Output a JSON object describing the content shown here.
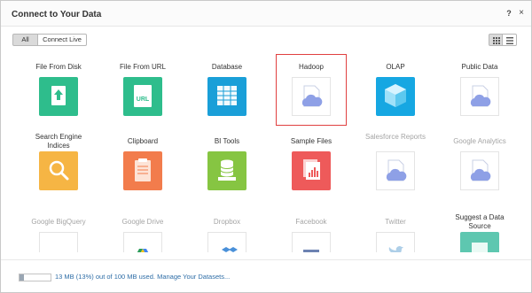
{
  "dialog": {
    "title": "Connect to Your Data",
    "help_label": "?",
    "close_label": "×"
  },
  "filters": {
    "all_label": "All",
    "live_label": "Connect Live",
    "active": "All"
  },
  "view_toggles": [
    "grid-view-icon",
    "list-view-icon"
  ],
  "sources": [
    {
      "label": "File From Disk",
      "icon": "upload-file-icon",
      "color": "#2ebd8c",
      "enabled": true
    },
    {
      "label": "File From URL",
      "icon": "url-file-icon",
      "color": "#2ebd8c",
      "enabled": true
    },
    {
      "label": "Database",
      "icon": "database-icon",
      "color": "#1a9fd8",
      "enabled": true
    },
    {
      "label": "Hadoop",
      "icon": "cloud-doc-icon",
      "color": "#ffffff",
      "enabled": true,
      "selected": true
    },
    {
      "label": "OLAP",
      "icon": "cube-icon",
      "color": "#16a7e2",
      "enabled": true
    },
    {
      "label": "Public Data",
      "icon": "cloud-doc-icon",
      "color": "#ffffff",
      "enabled": true
    },
    {
      "label": "Search Engine Indices",
      "icon": "magnifier-icon",
      "color": "#f6b544",
      "enabled": true
    },
    {
      "label": "Clipboard",
      "icon": "clipboard-icon",
      "color": "#f27c4c",
      "enabled": true
    },
    {
      "label": "BI Tools",
      "icon": "bi-database-icon",
      "color": "#86c542",
      "enabled": true
    },
    {
      "label": "Sample Files",
      "icon": "sample-chart-icon",
      "color": "#ee5a5a",
      "enabled": true
    },
    {
      "label": "Salesforce Reports",
      "icon": "cloud-doc-icon",
      "color": "#ffffff",
      "enabled": false
    },
    {
      "label": "Google Analytics",
      "icon": "cloud-doc-icon",
      "color": "#ffffff",
      "enabled": false
    },
    {
      "label": "Google BigQuery",
      "icon": "bigquery-icon",
      "color": "#ffffff",
      "enabled": false
    },
    {
      "label": "Google Drive",
      "icon": "google-drive-icon",
      "color": "#ffffff",
      "enabled": false
    },
    {
      "label": "Dropbox",
      "icon": "dropbox-icon",
      "color": "#ffffff",
      "enabled": false
    },
    {
      "label": "Facebook",
      "icon": "facebook-icon",
      "color": "#ffffff",
      "enabled": false
    },
    {
      "label": "Twitter",
      "icon": "twitter-icon",
      "color": "#ffffff",
      "enabled": false
    },
    {
      "label": "Suggest a Data Source",
      "icon": "suggest-icon",
      "color": "#5ec7b0",
      "enabled": true
    }
  ],
  "storage": {
    "used_fraction": 0.13,
    "text": "13 MB (13%) out of 100 MB used.",
    "manage_label": "Manage Your Datasets..."
  }
}
